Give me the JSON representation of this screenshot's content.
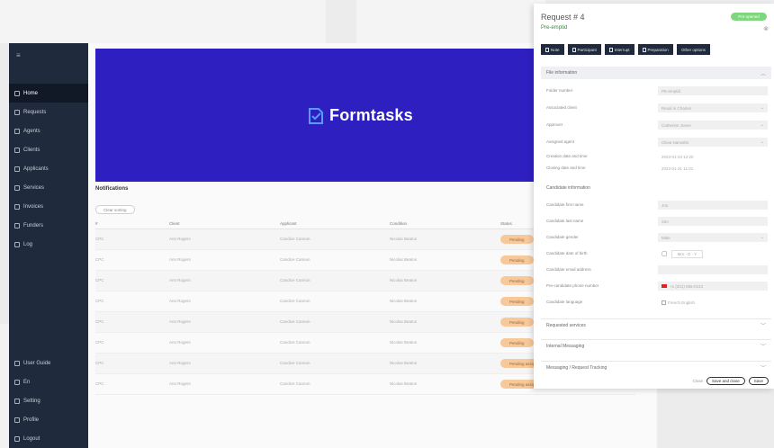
{
  "sidebar": {
    "items": [
      "Home",
      "Requests",
      "Agents",
      "Clients",
      "Applicants",
      "Services",
      "Invoices",
      "Funders",
      "Log"
    ],
    "bottom_items": [
      "User Guide",
      "En",
      "Setting",
      "Profile",
      "Logout"
    ]
  },
  "banner": {
    "brand": "Formtasks"
  },
  "notifications": {
    "title": "Notifications",
    "clear_label": "Clear sorting",
    "columns": [
      "#",
      "Client",
      "Applicant",
      "Condition",
      "Status"
    ],
    "rows": [
      {
        "id": "CPC",
        "client": "Ann Rogers",
        "applicant": "Candice Cannon",
        "condition": "Nicolas Beaton",
        "status": "Pending"
      },
      {
        "id": "CPC",
        "client": "Ann Rogers",
        "applicant": "Candice Cannon",
        "condition": "Nicolas Beaton",
        "status": "Pending"
      },
      {
        "id": "CPC",
        "client": "Ann Rogers",
        "applicant": "Candice Cannon",
        "condition": "Nicolas Beaton",
        "status": "Pending"
      },
      {
        "id": "CPC",
        "client": "Ann Rogers",
        "applicant": "Candice Cannon",
        "condition": "Nicolas Beaton",
        "status": "Pending"
      },
      {
        "id": "CPC",
        "client": "Ann Rogers",
        "applicant": "Candice Cannon",
        "condition": "Nicolas Beaton",
        "status": "Pending"
      },
      {
        "id": "CPC",
        "client": "Ann Rogers",
        "applicant": "Candice Cannon",
        "condition": "Nicolas Beaton",
        "status": "Pending"
      },
      {
        "id": "CPC",
        "client": "Ann Rogers",
        "applicant": "Candice Cannon",
        "condition": "Nicolas Beaton",
        "status": "Pending assignment"
      },
      {
        "id": "CPC",
        "client": "Ann Rogers",
        "applicant": "Candice Cannon",
        "condition": "Nicolas Beaton",
        "status": "Pending assignment"
      }
    ]
  },
  "request": {
    "title": "Request # 4",
    "subtitle": "Pre-emptid",
    "badge": "Pre-opened",
    "actions": [
      "Note",
      "Participant",
      "Interrupt",
      "Preparation",
      "Other options"
    ],
    "file_section": "File information",
    "fields": [
      {
        "label": "Folder number",
        "value": "PE-emptid"
      },
      {
        "label": "Associated client",
        "value": "Rexal in Charles"
      },
      {
        "label": "Approver",
        "value": "Catherine Jones"
      },
      {
        "label": "Assigned agent",
        "value": "Olivia Nanvahs"
      },
      {
        "label": "Creation date and time",
        "value": "2023-01-23 12:20"
      },
      {
        "label": "Closing date and time",
        "value": "2023-01-31 11:01"
      }
    ],
    "candidate_section": "Candidate information",
    "candidate_fields": [
      {
        "label": "Candidate first name",
        "value": "Jon"
      },
      {
        "label": "Candidate last name",
        "value": "Sim"
      },
      {
        "label": "Candidate gender",
        "value": "Male"
      },
      {
        "label": "Candidate date of birth",
        "value": "Mm  -  D  -  Y"
      },
      {
        "label": "Candidate email address",
        "value": ""
      },
      {
        "label": "Pre-candidate phone number",
        "value": "+1 (201) 555-0123"
      },
      {
        "label": "Candidate language",
        "value": "French    English"
      }
    ],
    "collapsed": [
      "Requested services",
      "Internal Messaging",
      "Messaging / Request Tracking"
    ],
    "footer": {
      "close": "Close",
      "save_close": "Save and close",
      "save": "Save"
    }
  }
}
